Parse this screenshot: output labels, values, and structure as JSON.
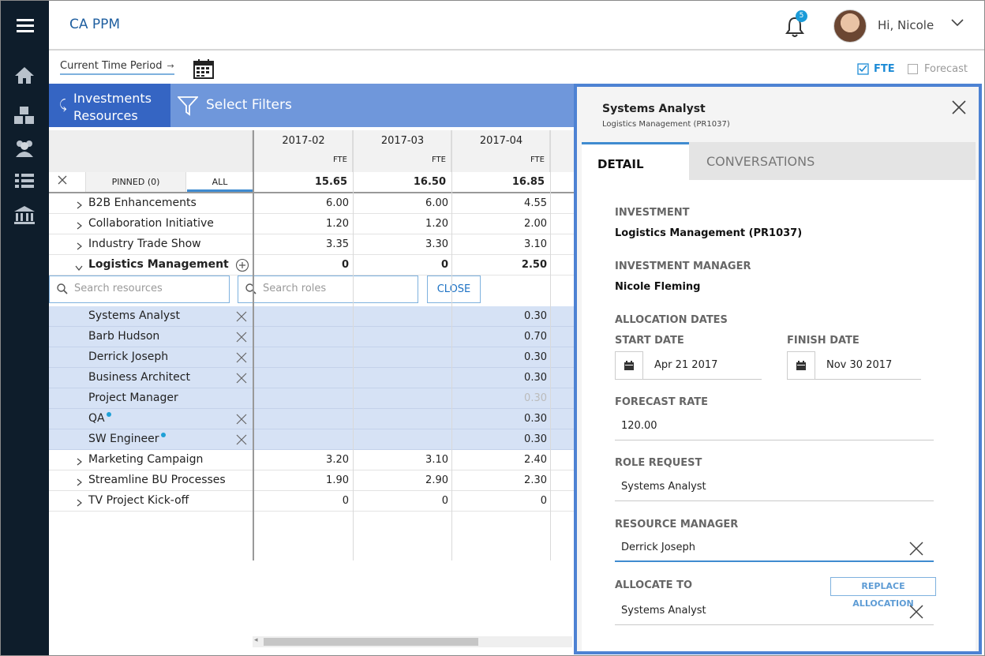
{
  "app": {
    "title": "CA PPM",
    "notifications": "5",
    "greeting": "Hi, Nicole"
  },
  "nav": {
    "icons": [
      "menu-icon",
      "home-icon",
      "cubes-icon",
      "people-icon",
      "list-icon",
      "bank-icon"
    ]
  },
  "toolbar": {
    "period": "Current Time Period",
    "fte_label": "FTE",
    "forecast_label": "Forecast",
    "fte_checked": true,
    "forecast_checked": false
  },
  "grid": {
    "tab_line1": "Investments",
    "tab_line2": "Resources",
    "filter_label": "Select Filters",
    "pinned_label": "PINNED (0)",
    "all_label": "ALL",
    "columns": [
      {
        "period": "2017-02",
        "unit": "FTE",
        "total": "15.65"
      },
      {
        "period": "2017-03",
        "unit": "FTE",
        "total": "16.50"
      },
      {
        "period": "2017-04",
        "unit": "FTE",
        "total": "16.85"
      }
    ],
    "investments_top": [
      {
        "name": "B2B Enhancements",
        "values": [
          "6.00",
          "6.00",
          "4.55"
        ]
      },
      {
        "name": "Collaboration Initiative",
        "values": [
          "1.20",
          "1.20",
          "2.00"
        ]
      },
      {
        "name": "Industry Trade Show",
        "values": [
          "3.35",
          "3.30",
          "3.10"
        ]
      }
    ],
    "expanded": {
      "name": "Logistics Management",
      "values": [
        "0",
        "0",
        "2.50"
      ]
    },
    "search_resources_placeholder": "Search resources",
    "search_roles_placeholder": "Search roles",
    "close_label": "CLOSE",
    "allocations": [
      {
        "name": "Systems Analyst",
        "value": "0.30",
        "removable": true,
        "dot": false,
        "muted": false
      },
      {
        "name": "Barb Hudson",
        "value": "0.70",
        "removable": true,
        "dot": false,
        "muted": false
      },
      {
        "name": "Derrick Joseph",
        "value": "0.30",
        "removable": true,
        "dot": false,
        "muted": false
      },
      {
        "name": "Business Architect",
        "value": "0.30",
        "removable": true,
        "dot": false,
        "muted": false
      },
      {
        "name": "Project Manager",
        "value": "0.30",
        "removable": false,
        "dot": false,
        "muted": true
      },
      {
        "name": "QA",
        "value": "0.30",
        "removable": true,
        "dot": true,
        "muted": false
      },
      {
        "name": "SW Engineer",
        "value": "0.30",
        "removable": true,
        "dot": true,
        "muted": false
      }
    ],
    "investments_bottom": [
      {
        "name": "Marketing Campaign",
        "values": [
          "3.20",
          "3.10",
          "2.40"
        ]
      },
      {
        "name": "Streamline BU Processes",
        "values": [
          "1.90",
          "2.90",
          "2.30"
        ]
      },
      {
        "name": "TV Project Kick-off",
        "values": [
          "0",
          "0",
          "0"
        ]
      }
    ]
  },
  "panel": {
    "title": "Systems Analyst",
    "subtitle": "Logistics Management (PR1037)",
    "tab_detail": "DETAIL",
    "tab_conversations": "CONVERSATIONS",
    "investment_label": "INVESTMENT",
    "investment_value": "Logistics Management (PR1037)",
    "manager_label": "INVESTMENT MANAGER",
    "manager_value": "Nicole Fleming",
    "alloc_dates_label": "ALLOCATION DATES",
    "start_label": "START DATE",
    "start_value": "Apr 21 2017",
    "finish_label": "FINISH DATE",
    "finish_value": "Nov 30 2017",
    "rate_label": "FORECAST RATE",
    "rate_value": "120.00",
    "role_label": "ROLE REQUEST",
    "role_value": "Systems Analyst",
    "resmgr_label": "RESOURCE MANAGER",
    "resmgr_value": "Derrick Joseph",
    "allocate_label": "ALLOCATE TO",
    "replace_label": "REPLACE ALLOCATION",
    "allocate_value": "Systems Analyst"
  },
  "colors": {
    "nav_bg": "#0e1d2b",
    "accent": "#3565c3",
    "filter_bar": "#6f97db",
    "selection": "#d6e2f5",
    "link": "#1f5fa0"
  }
}
